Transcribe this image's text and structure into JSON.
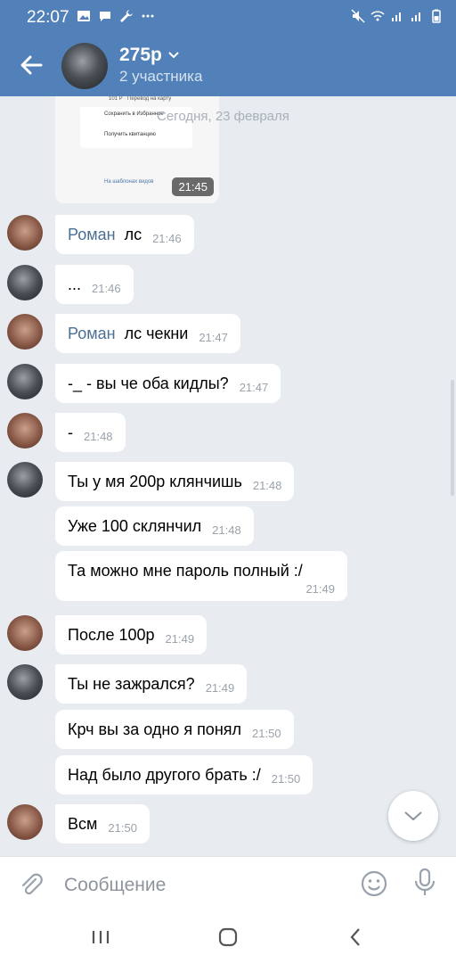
{
  "status_bar": {
    "time": "22:07"
  },
  "header": {
    "title": "275р",
    "subtitle": "2 участника"
  },
  "screenshot_preview": {
    "top_text": "101 Р · Перевод на карту",
    "item1": "Сохранить в Избранное",
    "item2": "Получить квитанцию",
    "link": "На шаблонах видов",
    "time": "21:45"
  },
  "date_separator": "Сегодня, 23 февраля",
  "messages": [
    {
      "sender": "Роман",
      "text": "лс",
      "time": "21:46"
    },
    {
      "sender": "",
      "text": "...",
      "time": "21:46"
    },
    {
      "sender": "Роман",
      "text": "лс чекни",
      "time": "21:47"
    },
    {
      "sender": "",
      "text": "-_ - вы че оба кидлы?",
      "time": "21:47"
    },
    {
      "sender": "",
      "text": "-",
      "time": "21:48"
    },
    {
      "sender": "",
      "text": "Ты у мя 200р клянчишь",
      "time": "21:48"
    },
    {
      "sender": "",
      "text": "Уже 100 склянчил",
      "time": "21:48"
    },
    {
      "sender": "",
      "text": "Та можно мне пароль полный :/",
      "time": "21:49"
    },
    {
      "sender": "",
      "text": "После 100р",
      "time": "21:49"
    },
    {
      "sender": "",
      "text": "Ты не зажрался?",
      "time": "21:49"
    },
    {
      "sender": "",
      "text": "Крч вы за одно я понял",
      "time": "21:50"
    },
    {
      "sender": "",
      "text": "Над было другого брать :/",
      "time": "21:50"
    },
    {
      "sender": "",
      "text": "Всм",
      "time": "21:50"
    }
  ],
  "composer": {
    "placeholder": "Сообщение"
  },
  "icons": {
    "back": "arrow-left-icon",
    "attach": "paperclip-icon",
    "emoji": "smile-icon",
    "mic": "microphone-icon",
    "scroll_down": "chevron-down-icon"
  },
  "colors": {
    "header": "#5181b8",
    "background": "#e8ecf1",
    "sender_name": "#4a6f94"
  }
}
